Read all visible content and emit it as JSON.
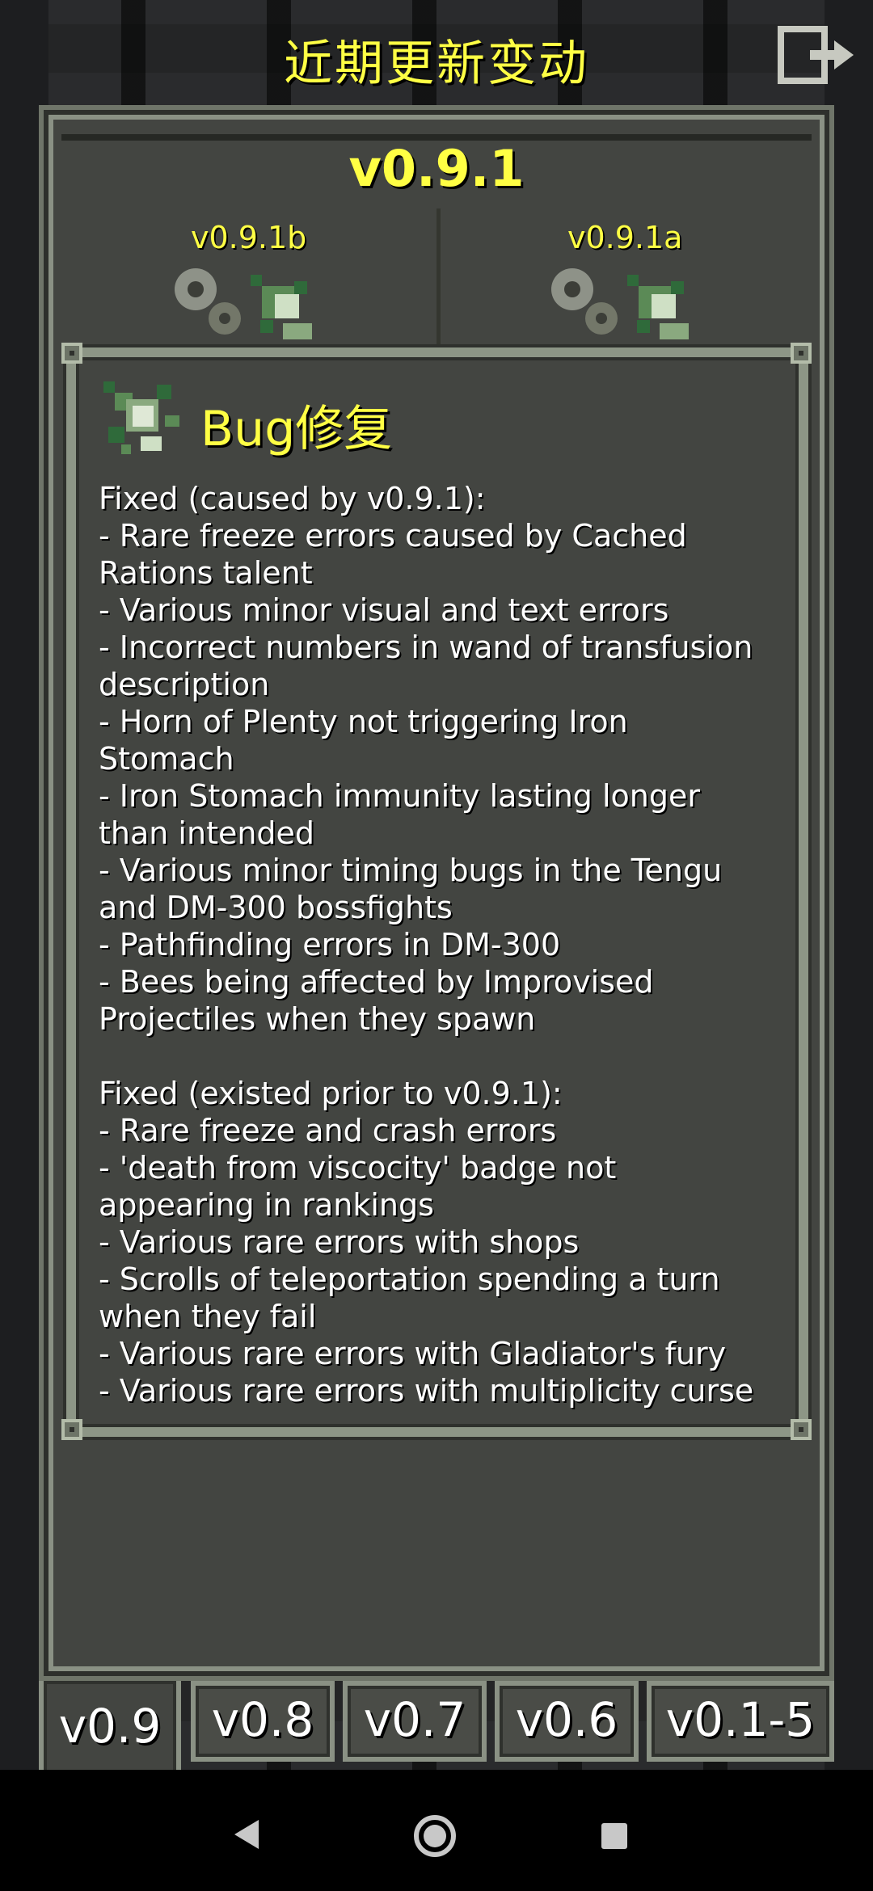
{
  "screen_title": "近期更新变动",
  "version": "v0.9.1",
  "subversions": [
    "v0.9.1b",
    "v0.9.1a"
  ],
  "window": {
    "title": "Bug修复",
    "lines": [
      "Fixed (caused by v0.9.1):",
      "- Rare freeze errors caused by Cached",
      "Rations talent",
      "- Various minor visual and text errors",
      "- Incorrect numbers in wand of transfusion",
      "description",
      "- Horn of Plenty not triggering Iron",
      "Stomach",
      "- Iron Stomach immunity lasting longer",
      "than intended",
      "- Various minor timing bugs in the Tengu",
      "and DM-300 bossfights",
      "- Pathfinding errors in DM-300",
      "- Bees being affected by Improvised",
      "Projectiles when they spawn",
      "",
      "Fixed (existed prior to v0.9.1):",
      "- Rare freeze and crash errors",
      "- 'death from viscocity' badge not",
      "appearing in rankings",
      "- Various rare errors with shops",
      "- Scrolls of teleportation spending a turn",
      "when they fail",
      "- Various rare errors with Gladiator's fury",
      "- Various rare errors with multiplicity curse"
    ]
  },
  "tabs": [
    "v0.9",
    "v0.8",
    "v0.7",
    "v0.6",
    "v0.1-5"
  ],
  "active_tab": "v0.9",
  "icons": {
    "exit": "exit-icon",
    "changes": "gears-icon",
    "bugfix": "bug-splat-icon"
  },
  "colors": {
    "accent_text": "#ffff44",
    "panel": "#434541",
    "border": "#8d9686"
  }
}
